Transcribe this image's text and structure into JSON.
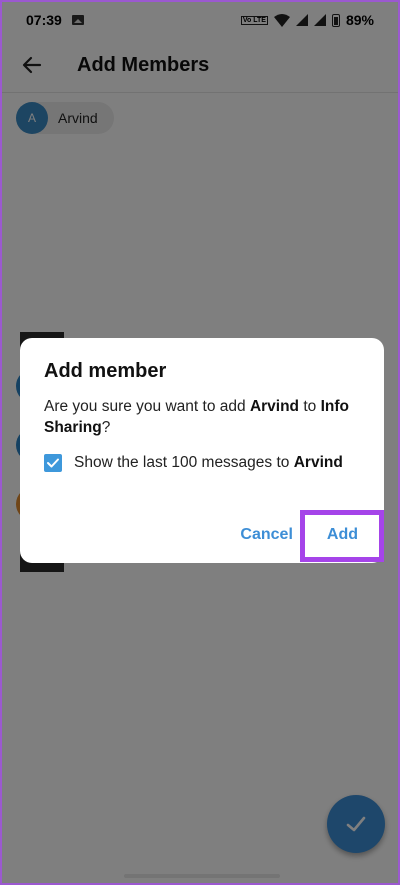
{
  "status_bar": {
    "time": "07:39",
    "network_badge": "Vo LTE",
    "battery": "89%"
  },
  "app_bar": {
    "title": "Add Members",
    "back_icon": "arrow-left-icon"
  },
  "selected_chip": {
    "avatar_letter": "A",
    "name": "Arvind"
  },
  "dialog": {
    "title": "Add member",
    "message_prefix": "Are you sure you want to add ",
    "member_name": "Arvind",
    "message_mid": " to ",
    "group_name": "Info Sharing",
    "message_suffix": "?",
    "checkbox_checked": true,
    "checkbox_label_prefix": "Show the last 100 messages to ",
    "checkbox_label_name": "Arvind",
    "cancel_label": "Cancel",
    "add_label": "Add"
  },
  "fab": {
    "icon": "check-icon"
  },
  "colors": {
    "accent": "#3d8ed6",
    "highlight": "#a544e9",
    "avatar": "#3b8ac4"
  }
}
